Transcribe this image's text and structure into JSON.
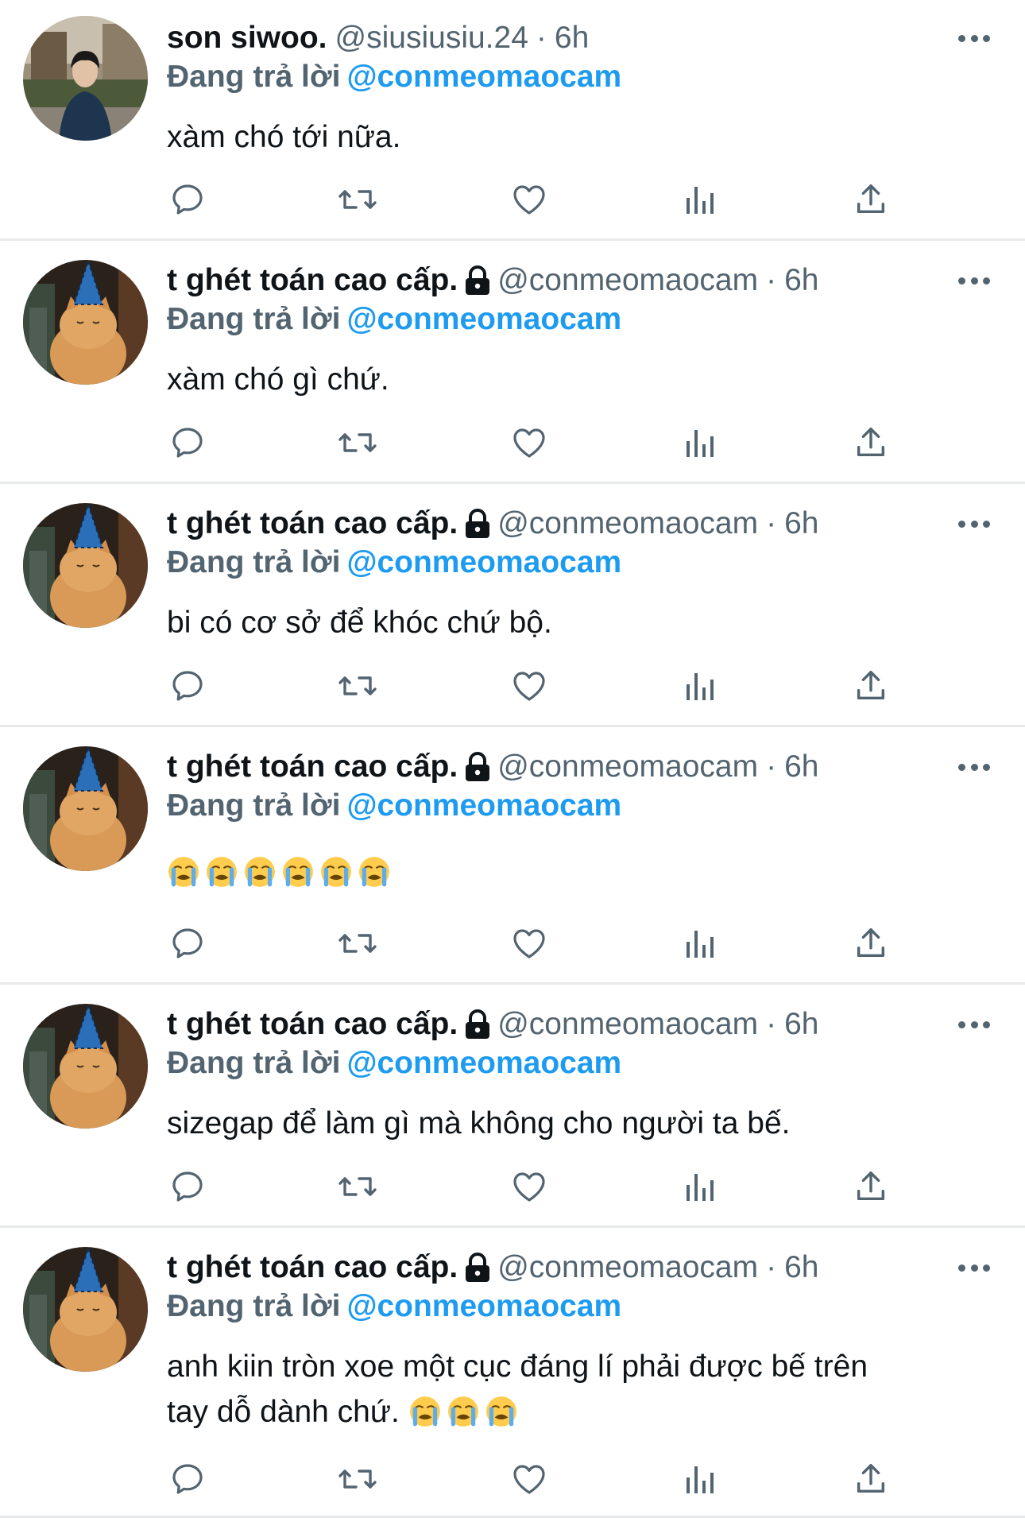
{
  "colors": {
    "accent": "#1d9bf0",
    "secondary": "#536471",
    "divider": "#e7e9ea"
  },
  "tweets": [
    {
      "display_name": "son siwoo.",
      "handle": "@siusiusiu.24",
      "dot": "·",
      "time": "6h",
      "locked": false,
      "avatar": "person-avatar",
      "reply_prefix": "Đang trả lời",
      "reply_to": "@conmeomaocam",
      "text_lines": [
        "xàm chó tới nữa."
      ],
      "emoji_count": 0
    },
    {
      "display_name": "t ghét toán cao cấp.",
      "handle": "@conmeomaocam",
      "dot": "·",
      "time": "6h",
      "locked": true,
      "avatar": "cat-party-hat-avatar",
      "reply_prefix": "Đang trả lời",
      "reply_to": "@conmeomaocam",
      "text_lines": [
        "xàm chó gì chứ."
      ],
      "emoji_count": 0
    },
    {
      "display_name": "t ghét toán cao cấp.",
      "handle": "@conmeomaocam",
      "dot": "·",
      "time": "6h",
      "locked": true,
      "avatar": "cat-party-hat-avatar",
      "reply_prefix": "Đang trả lời",
      "reply_to": "@conmeomaocam",
      "text_lines": [
        "bi có cơ sở để khóc chứ bộ."
      ],
      "emoji_count": 0
    },
    {
      "display_name": "t ghét toán cao cấp.",
      "handle": "@conmeomaocam",
      "dot": "·",
      "time": "6h",
      "locked": true,
      "avatar": "cat-party-hat-avatar",
      "reply_prefix": "Đang trả lời",
      "reply_to": "@conmeomaocam",
      "text_lines": [
        ""
      ],
      "emoji": "loudly-crying-face",
      "emoji_count": 6
    },
    {
      "display_name": "t ghét toán cao cấp.",
      "handle": "@conmeomaocam",
      "dot": "·",
      "time": "6h",
      "locked": true,
      "avatar": "cat-party-hat-avatar",
      "reply_prefix": "Đang trả lời",
      "reply_to": "@conmeomaocam",
      "text_lines": [
        "sizegap để làm gì mà không cho người ta bế."
      ],
      "emoji_count": 0
    },
    {
      "display_name": "t ghét toán cao cấp.",
      "handle": "@conmeomaocam",
      "dot": "·",
      "time": "6h",
      "locked": true,
      "avatar": "cat-party-hat-avatar",
      "reply_prefix": "Đang trả lời",
      "reply_to": "@conmeomaocam",
      "text_lines": [
        "anh kiin tròn xoe một cục đáng lí phải được bế trên",
        "tay dỗ dành chứ."
      ],
      "emoji": "loudly-crying-face",
      "emoji_count": 3
    }
  ],
  "actions": [
    "reply-icon",
    "retweet-icon",
    "like-icon",
    "views-icon",
    "share-icon"
  ]
}
